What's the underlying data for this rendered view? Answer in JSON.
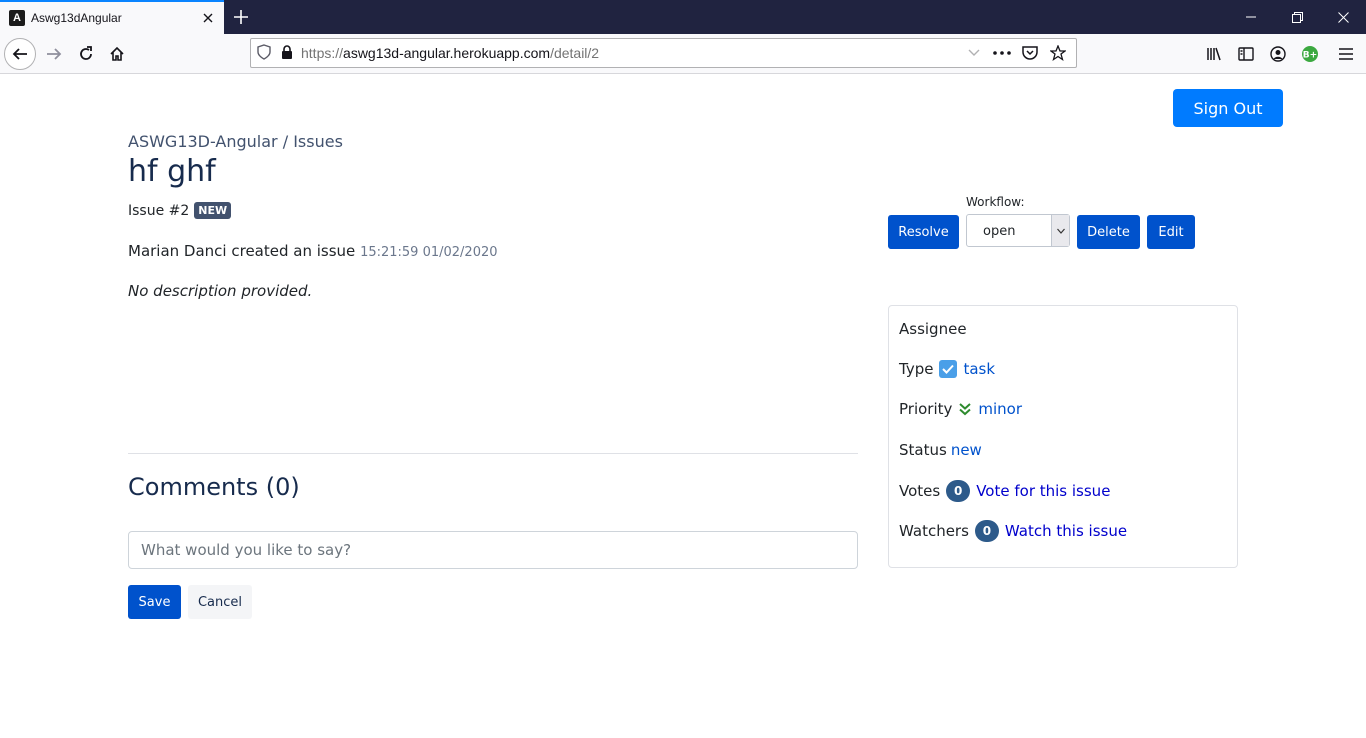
{
  "browser": {
    "tab_title": "Aswg13dAngular",
    "url_prefix": "https://",
    "url_host": "aswg13d-angular.herokuapp.com",
    "url_path": "/detail/2"
  },
  "header": {
    "signout_label": "Sign Out"
  },
  "issue": {
    "breadcrumb": "ASWG13D-Angular / Issues",
    "title": "hf ghf",
    "number_label": "Issue #2",
    "status_badge": "NEW",
    "created_by": "Marian Danci created an issue",
    "created_at": "15:21:59 01/02/2020",
    "description": "No description provided."
  },
  "actions": {
    "resolve_label": "Resolve",
    "workflow_label": "Workflow:",
    "workflow_value": "open",
    "delete_label": "Delete",
    "edit_label": "Edit"
  },
  "details": {
    "assignee_label": "Assignee",
    "type_label": "Type",
    "type_value": "task",
    "priority_label": "Priority",
    "priority_value": "minor",
    "status_label": "Status",
    "status_value": "new",
    "votes_label": "Votes",
    "votes_count": "0",
    "vote_link": "Vote for this issue",
    "watchers_label": "Watchers",
    "watchers_count": "0",
    "watch_link": "Watch this issue"
  },
  "comments": {
    "title": "Comments (0)",
    "placeholder": "What would you like to say?",
    "save_label": "Save",
    "cancel_label": "Cancel"
  },
  "colors": {
    "primary": "#0052cc",
    "signout": "#007bff",
    "badge": "#42526e"
  }
}
